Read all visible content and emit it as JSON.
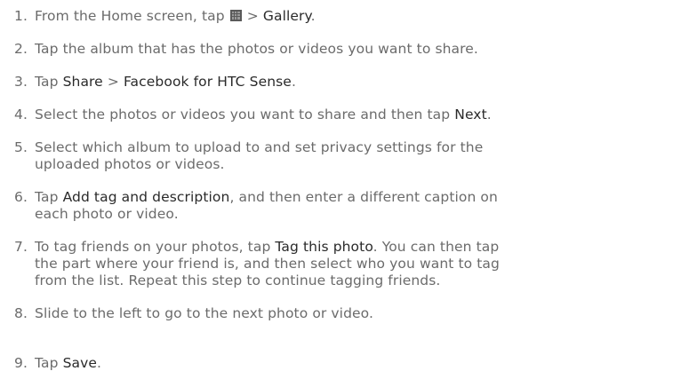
{
  "steps": [
    {
      "num": "1.",
      "segments": [
        {
          "t": "From the Home screen, tap "
        },
        {
          "icon": "apps-icon"
        },
        {
          "t": " > "
        },
        {
          "t": "Gallery",
          "hl": true
        },
        {
          "t": "."
        }
      ]
    },
    {
      "num": "2.",
      "segments": [
        {
          "t": "Tap the album that has the photos or videos you want to share."
        }
      ]
    },
    {
      "num": "3.",
      "segments": [
        {
          "t": "Tap "
        },
        {
          "t": "Share",
          "hl": true
        },
        {
          "t": " > "
        },
        {
          "t": "Facebook for HTC Sense",
          "hl": true
        },
        {
          "t": "."
        }
      ]
    },
    {
      "num": "4.",
      "segments": [
        {
          "t": "Select the photos or videos you want to share and then tap "
        },
        {
          "t": "Next",
          "hl": true
        },
        {
          "t": "."
        }
      ]
    },
    {
      "num": "5.",
      "lines": [
        [
          {
            "t": "Select which album to upload to and set privacy settings for the"
          }
        ],
        [
          {
            "t": "uploaded photos or videos."
          }
        ]
      ]
    },
    {
      "num": "6.",
      "lines": [
        [
          {
            "t": "Tap "
          },
          {
            "t": "Add tag and description",
            "hl": true
          },
          {
            "t": ", and then enter a different caption on"
          }
        ],
        [
          {
            "t": "each photo or video."
          }
        ]
      ]
    },
    {
      "num": "7.",
      "lines": [
        [
          {
            "t": "To tag friends on your photos, tap "
          },
          {
            "t": "Tag this photo",
            "hl": true
          },
          {
            "t": ". You can then tap"
          }
        ],
        [
          {
            "t": "the part where your friend is, and then select who you want to tag"
          }
        ],
        [
          {
            "t": "from the list. Repeat this step to continue tagging friends."
          }
        ]
      ]
    },
    {
      "num": "8.",
      "segments": [
        {
          "t": "Slide to the left to go to the next photo or video."
        }
      ]
    },
    {
      "num": "9.",
      "segments": [
        {
          "t": "Tap "
        },
        {
          "t": "Save",
          "hl": true
        },
        {
          "t": "."
        }
      ]
    }
  ]
}
